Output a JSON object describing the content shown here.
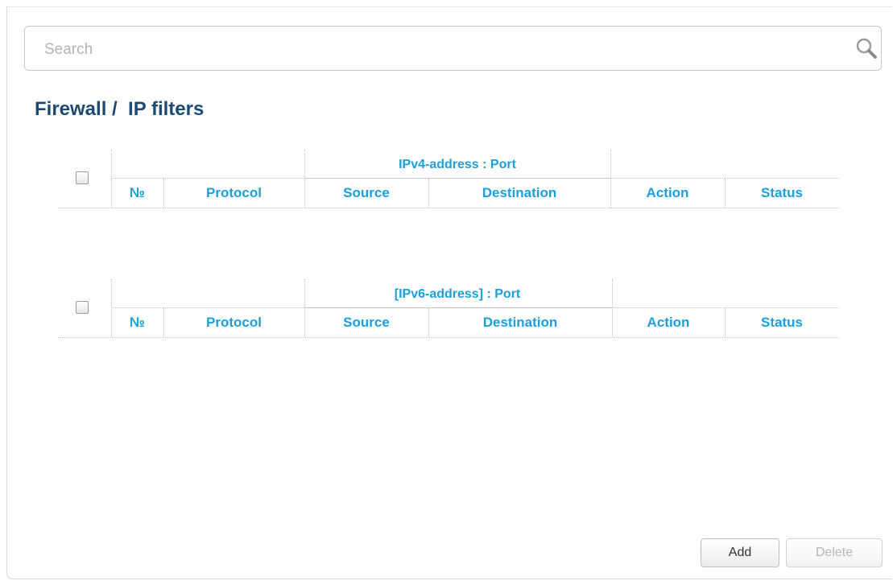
{
  "search": {
    "placeholder": "Search",
    "icon": "search-icon"
  },
  "page": {
    "title": "Firewall /  IP filters"
  },
  "tables": [
    {
      "group_title": "IPv4-address : Port",
      "columns": [
        "№",
        "Protocol",
        "Source",
        "Destination",
        "Action",
        "Status"
      ]
    },
    {
      "group_title": "[IPv6-address] : Port",
      "columns": [
        "№",
        "Protocol",
        "Source",
        "Destination",
        "Action",
        "Status"
      ]
    }
  ],
  "buttons": {
    "add": "Add",
    "delete": "Delete"
  },
  "colors": {
    "title": "#1c4a75",
    "header": "#1a9fdb"
  }
}
